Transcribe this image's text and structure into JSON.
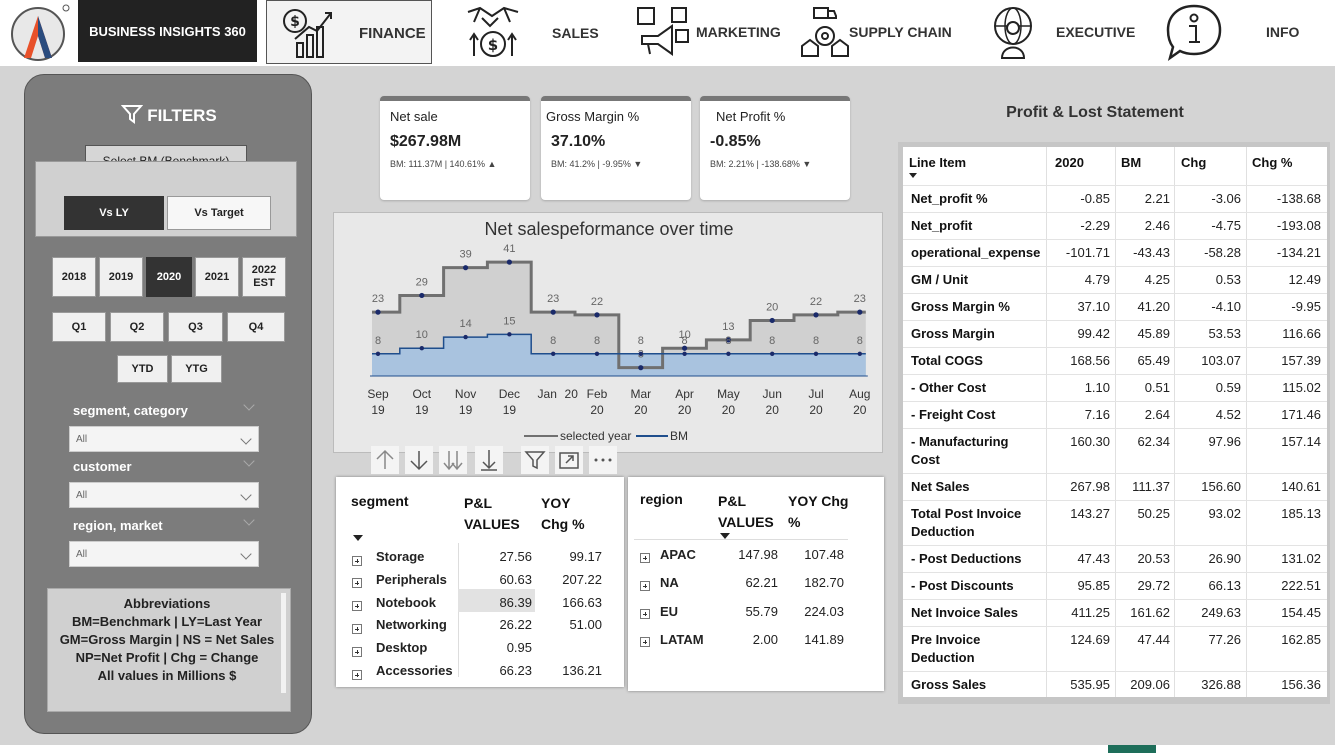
{
  "app": {
    "brand": "BUSINESS INSIGHTS 360"
  },
  "nav": [
    {
      "label": "FINANCE",
      "icon": "finance-growth-icon",
      "active": true
    },
    {
      "label": "SALES",
      "icon": "handshake-money-icon"
    },
    {
      "label": "MARKETING",
      "icon": "megaphone-icon"
    },
    {
      "label": "SUPPLY CHAIN",
      "icon": "delivery-truck-gear-icon"
    },
    {
      "label": "EXECUTIVE",
      "icon": "executive-globe-icon"
    },
    {
      "label": "INFO",
      "icon": "info-bubble-icon"
    }
  ],
  "filters": {
    "title": "FILTERS",
    "benchmark_button": "Select BM (Benchmark)",
    "compare": [
      "Vs LY",
      "Vs Target"
    ],
    "compare_selected": "Vs LY",
    "years": [
      "2018",
      "2019",
      "2020",
      "2021",
      "2022 EST"
    ],
    "year_selected": "2020",
    "quarters": [
      "Q1",
      "Q2",
      "Q3",
      "Q4"
    ],
    "ytd": [
      "YTD",
      "YTG"
    ],
    "slicers": [
      {
        "label": "segment, category",
        "value": "All"
      },
      {
        "label": "customer",
        "value": "All"
      },
      {
        "label": "region, market",
        "value": "All"
      }
    ],
    "abbreviations": {
      "title": "Abbreviations",
      "lines": [
        "BM=Benchmark | LY=Last Year",
        "GM=Gross Margin | NS = Net Sales",
        "NP=Net Profit | Chg = Change",
        "All values in Millions $"
      ]
    }
  },
  "kpis": [
    {
      "title": "Net sale",
      "value": "$267.98M",
      "sub": "BM: 111.37M | 140.61% ▲"
    },
    {
      "title": "Gross Margin %",
      "value": "37.10%",
      "sub": "BM: 41.2% | -9.95% ▼"
    },
    {
      "title": "Net Profit %",
      "value": "-0.85%",
      "sub": "BM: 2.21% | -138.68% ▼"
    }
  ],
  "chart_data": {
    "type": "line",
    "title": "Net salespeformance over time",
    "categories": [
      "Sep 19",
      "Oct 19",
      "Nov 19",
      "Dec 19",
      "Jan 20",
      "Feb 20",
      "Mar 20",
      "Apr 20",
      "May 20",
      "Jun 20",
      "Jul 20",
      "Aug 20"
    ],
    "series": [
      {
        "name": "selected year",
        "values": [
          23,
          29,
          39,
          41,
          23,
          22,
          3,
          10,
          13,
          20,
          22,
          23
        ],
        "color": "#707070"
      },
      {
        "name": "BM",
        "values": [
          8,
          10,
          14,
          15,
          8,
          8,
          8,
          8,
          8,
          8,
          8,
          8
        ],
        "color": "#1f4e8c"
      }
    ],
    "legend": "bottom-center",
    "ylim": [
      0,
      45
    ]
  },
  "visual_toolbar": [
    "arrow-up-icon",
    "arrow-down-icon",
    "double-arrow-down-icon",
    "expand-hierarchy-icon",
    "filter-icon",
    "focus-mode-icon",
    "more-options-icon"
  ],
  "segment_table": {
    "headers": [
      "segment",
      "P&L VALUES",
      "YOY Chg %"
    ],
    "rows": [
      {
        "name": "Storage",
        "pl": "27.56",
        "yoy": "99.17"
      },
      {
        "name": "Peripherals",
        "pl": "60.63",
        "yoy": "207.22"
      },
      {
        "name": "Notebook",
        "pl": "86.39",
        "yoy": "166.63"
      },
      {
        "name": "Networking",
        "pl": "26.22",
        "yoy": "51.00"
      },
      {
        "name": "Desktop",
        "pl": "0.95",
        "yoy": ""
      },
      {
        "name": "Accessories",
        "pl": "66.23",
        "yoy": "136.21"
      }
    ]
  },
  "region_table": {
    "headers": [
      "region",
      "P&L VALUES",
      "YOY Chg %"
    ],
    "rows": [
      {
        "name": "APAC",
        "pl": "147.98",
        "yoy": "107.48"
      },
      {
        "name": "NA",
        "pl": "62.21",
        "yoy": "182.70"
      },
      {
        "name": "EU",
        "pl": "55.79",
        "yoy": "224.03"
      },
      {
        "name": "LATAM",
        "pl": "2.00",
        "yoy": "141.89"
      }
    ]
  },
  "pnl": {
    "title": "Profit & Lost Statement",
    "headers": [
      "Line Item",
      "2020",
      "BM",
      "Chg",
      "Chg %"
    ],
    "rows": [
      {
        "item": "Net_profit %",
        "y": "-0.85",
        "bm": "2.21",
        "chg": "-3.06",
        "pct": "-138.68"
      },
      {
        "item": "Net_profit",
        "y": "-2.29",
        "bm": "2.46",
        "chg": "-4.75",
        "pct": "-193.08"
      },
      {
        "item": "operational_expense",
        "y": "-101.71",
        "bm": "-43.43",
        "chg": "-58.28",
        "pct": "-134.21"
      },
      {
        "item": "GM / Unit",
        "y": "4.79",
        "bm": "4.25",
        "chg": "0.53",
        "pct": "12.49"
      },
      {
        "item": "Gross Margin %",
        "y": "37.10",
        "bm": "41.20",
        "chg": "-4.10",
        "pct": "-9.95"
      },
      {
        "item": "Gross Margin",
        "y": "99.42",
        "bm": "45.89",
        "chg": "53.53",
        "pct": "116.66"
      },
      {
        "item": "Total COGS",
        "y": "168.56",
        "bm": "65.49",
        "chg": "103.07",
        "pct": "157.39"
      },
      {
        "item": "- Other Cost",
        "y": "1.10",
        "bm": "0.51",
        "chg": "0.59",
        "pct": "115.02"
      },
      {
        "item": "- Freight Cost",
        "y": "7.16",
        "bm": "2.64",
        "chg": "4.52",
        "pct": "171.46"
      },
      {
        "item": "- Manufacturing Cost",
        "y": "160.30",
        "bm": "62.34",
        "chg": "97.96",
        "pct": "157.14"
      },
      {
        "item": "Net Sales",
        "y": "267.98",
        "bm": "111.37",
        "chg": "156.60",
        "pct": "140.61"
      },
      {
        "item": "Total Post Invoice Deduction",
        "y": "143.27",
        "bm": "50.25",
        "chg": "93.02",
        "pct": "185.13"
      },
      {
        "item": "- Post Deductions",
        "y": "47.43",
        "bm": "20.53",
        "chg": "26.90",
        "pct": "131.02"
      },
      {
        "item": "- Post Discounts",
        "y": "95.85",
        "bm": "29.72",
        "chg": "66.13",
        "pct": "222.51"
      },
      {
        "item": "Net Invoice Sales",
        "y": "411.25",
        "bm": "161.62",
        "chg": "249.63",
        "pct": "154.45"
      },
      {
        "item": "Pre Invoice Deduction",
        "y": "124.69",
        "bm": "47.44",
        "chg": "77.26",
        "pct": "162.85"
      },
      {
        "item": "Gross Sales",
        "y": "535.95",
        "bm": "209.06",
        "chg": "326.88",
        "pct": "156.36"
      }
    ]
  }
}
